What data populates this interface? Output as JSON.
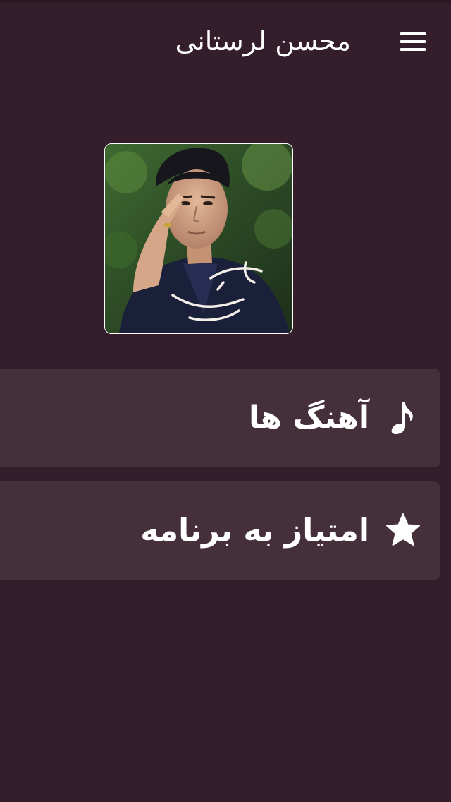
{
  "header": {
    "title": "محسن لرستانی",
    "menu_icon": "hamburger-menu-icon"
  },
  "artist_photo": {
    "alt": "محسن لرستانی",
    "caption_lettering": "محسن لرستانی"
  },
  "menu": {
    "items": [
      {
        "label": "آهنگ ها",
        "icon": "music-note-icon"
      },
      {
        "label": "امتیاز به برنامه",
        "icon": "star-icon"
      }
    ]
  },
  "colors": {
    "background": "#341e2b",
    "card": "#452f3b",
    "text": "#ffffff"
  }
}
